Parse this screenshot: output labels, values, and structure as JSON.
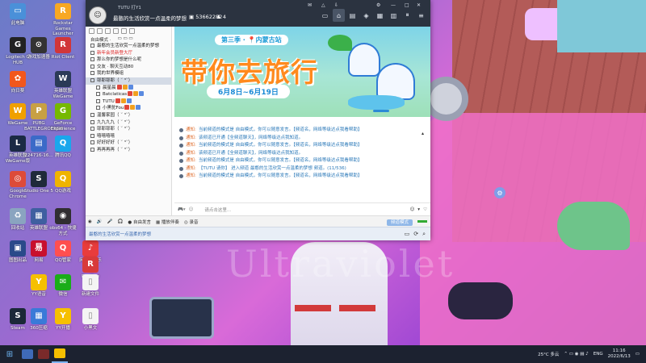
{
  "desktop": {
    "icons": [
      {
        "label": "此电脑",
        "color": "#4a90d9",
        "glyph": "▭"
      },
      {
        "label": "Rockstar Games Launcher",
        "color": "#f8a823",
        "glyph": "R"
      },
      {
        "label": "Logitech G HUB",
        "color": "#222222",
        "glyph": "G"
      },
      {
        "label": "游戏加速器",
        "color": "#333333",
        "glyph": "⊙"
      },
      {
        "label": "Riot Client",
        "color": "#d13639",
        "glyph": "R"
      },
      {
        "label": "向日葵",
        "color": "#f2571d",
        "glyph": "✿"
      },
      {
        "label": "英雄联盟WeGame",
        "color": "#2b3a57",
        "glyph": "W"
      },
      {
        "label": "WeGame",
        "color": "#f0a000",
        "glyph": "W"
      },
      {
        "label": "PUBG BATTLEGROUNDS",
        "color": "#c8a043",
        "glyph": "P"
      },
      {
        "label": "GeForce Experience",
        "color": "#76b900",
        "glyph": "G"
      },
      {
        "label": "英雄联盟WeGame版",
        "color": "#1b2a45",
        "glyph": "L"
      },
      {
        "label": "224716-16...",
        "color": "#3b6ac8",
        "glyph": "▤"
      },
      {
        "label": "腾讯QQ",
        "color": "#1aa7ec",
        "glyph": "Q"
      },
      {
        "label": "Google Chrome",
        "color": "#dd4b39",
        "glyph": "◎"
      },
      {
        "label": "Studio One 5",
        "color": "#1f2a3a",
        "glyph": "S"
      },
      {
        "label": "QQ游戏",
        "color": "#f0b400",
        "glyph": "Q"
      },
      {
        "label": "回收站",
        "color": "#8aa4c0",
        "glyph": "♻"
      },
      {
        "label": "英雄联盟",
        "color": "#3f5fa0",
        "glyph": "▦"
      },
      {
        "label": "obs64 - 快捷方式",
        "color": "#302e31",
        "glyph": "◉"
      },
      {
        "label": "图图出品",
        "color": "#2a4a8a",
        "glyph": "▣"
      },
      {
        "label": "网易",
        "color": "#c8102e",
        "glyph": "易"
      },
      {
        "label": "QQ管家",
        "color": "#ff4f4f",
        "glyph": "Q"
      },
      {
        "label": "网易云音乐",
        "color": "#e83c3c",
        "glyph": "♪"
      },
      {
        "label": "RealSee",
        "color": "#d83a3a",
        "glyph": "R"
      },
      {
        "label": "YY语音",
        "color": "#f6c000",
        "glyph": "Y"
      },
      {
        "label": "微信",
        "color": "#1aad19",
        "glyph": "✉"
      },
      {
        "label": "新建文件",
        "color": "#f4f4f4",
        "glyph": "▯"
      },
      {
        "label": "Steam",
        "color": "#1b2838",
        "glyph": "S"
      },
      {
        "label": "360压缩",
        "color": "#3a7ad8",
        "glyph": "▦"
      },
      {
        "label": "YY开播",
        "color": "#f6c000",
        "glyph": "Y"
      },
      {
        "label": "小黑文",
        "color": "#f4f4f4",
        "glyph": "▯"
      }
    ]
  },
  "window": {
    "user_name": "TUTU 打Y1",
    "room_title": "最憨的生活欣赏一点温柔的梦想",
    "room_id": "53662282",
    "online_count": "4",
    "title_extras": [
      "✉",
      "△",
      "⇩",
      "⚙",
      "—",
      "□",
      "✕"
    ],
    "toolbar": [
      {
        "name": "screen-icon",
        "glyph": "▭"
      },
      {
        "name": "home-icon",
        "glyph": "⌂"
      },
      {
        "name": "list-icon",
        "glyph": "▤"
      },
      {
        "name": "game-icon",
        "glyph": "◈"
      },
      {
        "name": "grid-icon",
        "glyph": "▦"
      },
      {
        "name": "card-icon",
        "glyph": "▥"
      },
      {
        "name": "pause-icon",
        "glyph": "⏸"
      },
      {
        "name": "menu-icon",
        "glyph": "≡"
      }
    ],
    "sidebar": {
      "mode": "自由模式 ·",
      "lines": [
        {
          "text": "最憨的生活欣赏一点温柔的梦想",
          "style": ""
        },
        {
          "text": "新年会员新登大厅",
          "style": "red"
        },
        {
          "text": "那么你的梦想是什么呢",
          "style": ""
        },
        {
          "text": "交友 · 聊天互动80",
          "style": ""
        },
        {
          "text": "我的世界模组",
          "style": ""
        },
        {
          "text": "耶耶耶耶（  ˘ ³˘）",
          "style": "sel"
        },
        {
          "text": "晨星晨",
          "style": "indent"
        },
        {
          "text": "Batclaticas",
          "style": "indent"
        },
        {
          "text": "TUTU",
          "style": "indent"
        },
        {
          "text": "小黑驼Fou",
          "style": "indent"
        },
        {
          "text": "温馨家园（  ˘ ³˘）",
          "style": ""
        },
        {
          "text": "九九九九（  ˘ ³˘）",
          "style": ""
        },
        {
          "text": "耶耶耶耶（  ˘ ³˘）",
          "style": ""
        },
        {
          "text": "嘻嘻嘻嘻",
          "style": ""
        },
        {
          "text": "好好好好（  ˘ ³˘）",
          "style": ""
        },
        {
          "text": "再再再再（  ˘ ³˘）",
          "style": ""
        }
      ]
    },
    "banner": {
      "season": "第三季 · 📍内蒙古站",
      "title": "带你去旅行",
      "date": "6月8日~6月19日"
    },
    "messages": [
      {
        "prefix": "通知:",
        "text": "当前频道的模式是 自由模式，你可以随意发言。【频道名，网络等级达点我看帮助】"
      },
      {
        "prefix": "通知:",
        "text": "该频道已开通【全频道聊天】，网络等级达点我知道。"
      },
      {
        "prefix": "通知:",
        "text": "当前频道的模式是 自由模式，你可以随意发言。【频道名，网络等级达点我看帮助】"
      },
      {
        "prefix": "通知:",
        "text": "该频道已开通【全频道聊天】，网络等级达点我知道。"
      },
      {
        "prefix": "通知:",
        "text": "当前频道的模式是 自由模式，你可以随意发言。【频道名，网络等级达点我看帮助】"
      },
      {
        "prefix": "通知:",
        "text": "【TUTU 请你】 进入频道 最憨的生活欣赏一点温柔的梦想 频道。(11/536)"
      },
      {
        "prefix": "通知:",
        "text": "当前频道的模式是 自由模式，你可以随意发言。【频道名，网络等级达点我看帮助】"
      }
    ],
    "input_placeholder": "请点击这里...",
    "input_right": [
      "☺",
      "▾",
      "♡"
    ],
    "bottombar": {
      "free_speak": "自由发言",
      "broadcast": "播放伴奏",
      "record": "录音",
      "channel_mode": "频道模式"
    },
    "status": "最憨的生活欣赏一点温柔的梦想",
    "status_icons": [
      "▭",
      "⟳",
      "⌕"
    ]
  },
  "taskbar": {
    "weather": "25°C 多云",
    "lang": "ENG",
    "time": "11:16",
    "date": "2022/6/13"
  }
}
